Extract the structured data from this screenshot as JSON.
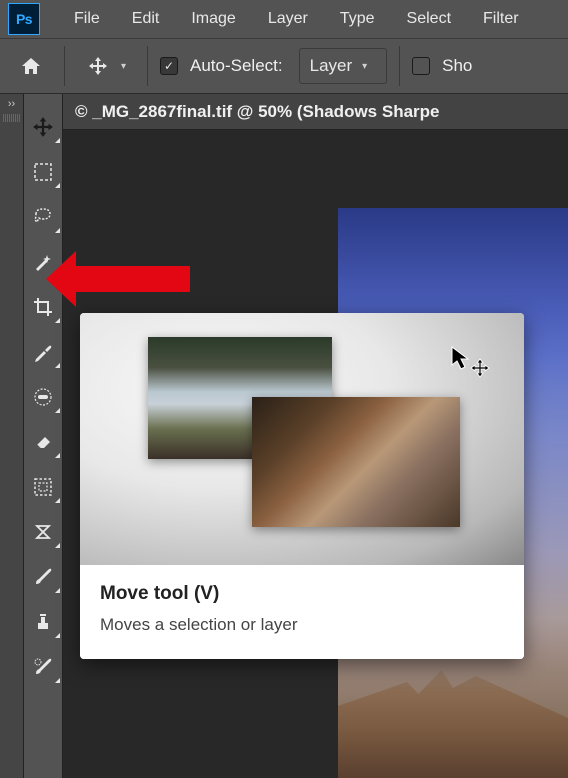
{
  "app": {
    "logo_text": "Ps"
  },
  "menubar": {
    "items": [
      "File",
      "Edit",
      "Image",
      "Layer",
      "Type",
      "Select",
      "Filter"
    ]
  },
  "optionsbar": {
    "auto_select_checked": true,
    "auto_select_label": "Auto-Select:",
    "target_dropdown": "Layer",
    "show_transform_checked": false,
    "show_transform_label": "Sho"
  },
  "document": {
    "tab_title": "© _MG_2867final.tif @ 50% (Shadows Sharpe"
  },
  "tooltip": {
    "title": "Move tool (V)",
    "desc": "Moves a selection or layer"
  },
  "tools": [
    {
      "name": "move-tool-icon"
    },
    {
      "name": "marquee-tool-icon"
    },
    {
      "name": "lasso-tool-icon"
    },
    {
      "name": "magic-wand-tool-icon"
    },
    {
      "name": "crop-tool-icon"
    },
    {
      "name": "eyedropper-tool-icon"
    },
    {
      "name": "spot-heal-tool-icon"
    },
    {
      "name": "eraser-tool-icon"
    },
    {
      "name": "selection-brush-tool-icon"
    },
    {
      "name": "content-aware-move-tool-icon"
    },
    {
      "name": "brush-tool-icon"
    },
    {
      "name": "clone-stamp-tool-icon"
    },
    {
      "name": "history-brush-tool-icon"
    }
  ]
}
